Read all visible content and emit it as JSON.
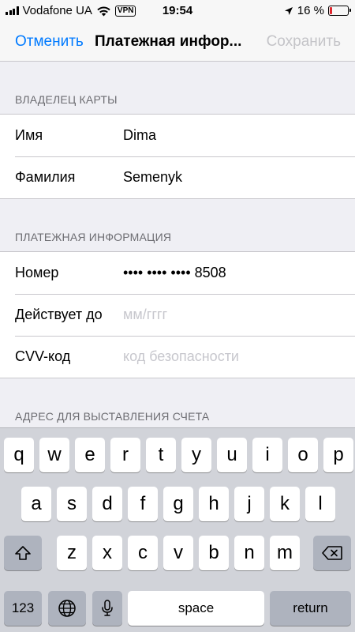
{
  "status_bar": {
    "carrier": "Vodafone UA",
    "vpn": "VPN",
    "time": "19:54",
    "battery_percent_label": "16 %",
    "battery_level": 0.16,
    "battery_color": "#e0262d"
  },
  "nav": {
    "cancel_label": "Отменить",
    "title": "Платежная инфор...",
    "save_label": "Сохранить"
  },
  "card_owner": {
    "header": "ВЛАДЕЛЕЦ КАРТЫ",
    "rows": [
      {
        "label": "Имя",
        "value": "Dima"
      },
      {
        "label": "Фамилия",
        "value": "Semenyk"
      }
    ]
  },
  "payment_info": {
    "header": "ПЛАТЕЖНАЯ ИНФОРМАЦИЯ",
    "rows": [
      {
        "label": "Номер",
        "value": "•••• •••• •••• 8508"
      },
      {
        "label": "Действует до",
        "placeholder": "мм/гггг"
      },
      {
        "label": "CVV-код",
        "placeholder": "код безопасности"
      }
    ]
  },
  "billing_address": {
    "header": "АДРЕС ДЛЯ ВЫСТАВЛЕНИЯ СЧЕТА"
  },
  "keyboard": {
    "row1": [
      "q",
      "w",
      "e",
      "r",
      "t",
      "y",
      "u",
      "i",
      "o",
      "p"
    ],
    "row2": [
      "a",
      "s",
      "d",
      "f",
      "g",
      "h",
      "j",
      "k",
      "l"
    ],
    "row3": [
      "z",
      "x",
      "c",
      "v",
      "b",
      "n",
      "m"
    ],
    "numbers_label": "123",
    "space_label": "space",
    "return_label": "return",
    "icons": {
      "shift": "shift-icon",
      "backspace": "backspace-icon",
      "globe": "globe-icon",
      "mic": "microphone-icon"
    }
  },
  "colors": {
    "accent": "#007aff",
    "disabled": "#c4c4c8",
    "placeholder": "#c7c7cd",
    "background": "#efeff4"
  }
}
